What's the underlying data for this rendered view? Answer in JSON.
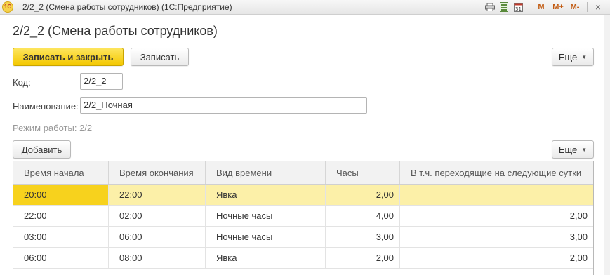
{
  "window": {
    "title": "2/2_2 (Смена работы сотрудников)  (1С:Предприятие)",
    "app_logo": "1С",
    "toolbar_icons": [
      "printer-icon",
      "calculator-icon",
      "calendar-icon"
    ],
    "memory_buttons": [
      "M",
      "M+",
      "M-"
    ],
    "close": "×"
  },
  "form": {
    "title": "2/2_2 (Смена работы сотрудников)",
    "save_close_label": "Записать и закрыть",
    "save_label": "Записать",
    "more_label": "Еще",
    "code_label": "Код:",
    "code_value": "2/2_2",
    "name_label": "Наименование:",
    "name_value": "2/2_Ночная",
    "mode_text": "Режим работы:  2/2"
  },
  "table": {
    "add_label": "Добавить",
    "more_label": "Еще",
    "columns": [
      "Время начала",
      "Время окончания",
      "Вид времени",
      "Часы",
      "В т.ч. переходящие на следующие сутки"
    ],
    "rows": [
      [
        "20:00",
        "22:00",
        "Явка",
        "2,00",
        ""
      ],
      [
        "22:00",
        "02:00",
        "Ночные часы",
        "4,00",
        "2,00"
      ],
      [
        "03:00",
        "06:00",
        "Ночные часы",
        "3,00",
        "3,00"
      ],
      [
        "06:00",
        "08:00",
        "Явка",
        "2,00",
        "2,00"
      ]
    ],
    "selected_row": 0
  },
  "colors": {
    "primary_button": "#f4c800",
    "selected_row": "#fcf0a8",
    "current_cell": "#f7d21d"
  }
}
